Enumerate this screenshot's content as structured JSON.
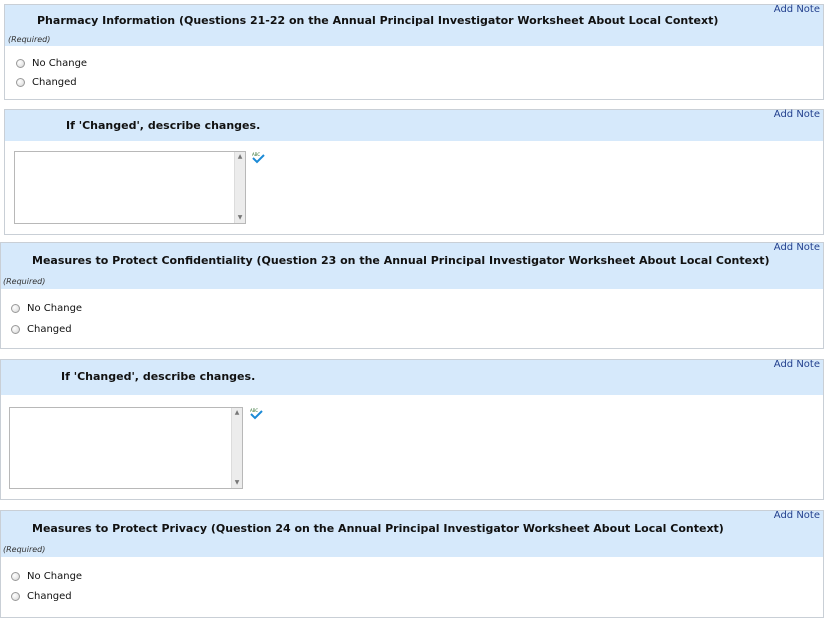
{
  "sections": [
    {
      "add_note": "Add Note",
      "title": "Pharmacy Information (Questions 21-22 on the Annual Principal Investigator Worksheet About Local Context)",
      "required": "(Required)",
      "options": [
        "No Change",
        "Changed"
      ]
    },
    {
      "add_note": "Add Note",
      "title": "If 'Changed', describe changes."
    },
    {
      "add_note": "Add Note",
      "title": "Measures to Protect Confidentiality (Question 23 on the Annual Principal Investigator Worksheet About Local Context)",
      "required": "(Required)",
      "options": [
        "No Change",
        "Changed"
      ]
    },
    {
      "add_note": "Add Note",
      "title": "If 'Changed', describe changes."
    },
    {
      "add_note": "Add Note",
      "title": "Measures to Protect Privacy (Question 24 on the Annual Principal Investigator Worksheet About Local Context)",
      "required": "(Required)",
      "options": [
        "No Change",
        "Changed"
      ]
    }
  ],
  "icons": {
    "spell_check": "spell-check-icon",
    "scroll_up": "triangle-up-icon",
    "scroll_down": "triangle-down-icon"
  },
  "colors": {
    "header_band": "#d6e9fb",
    "add_note_link": "#23408e",
    "section_border": "#c9cfd6"
  }
}
